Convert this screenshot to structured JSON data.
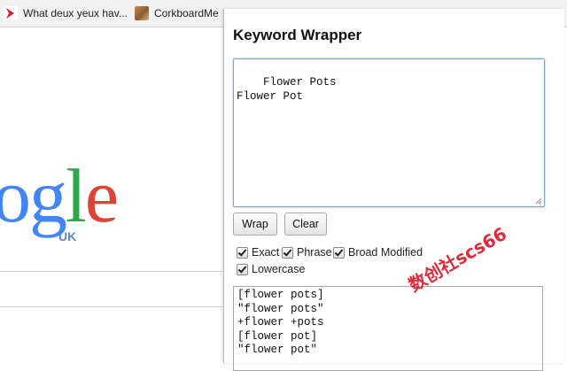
{
  "bookmarks": [
    {
      "label": "What deux yeux hav...",
      "icon": "red-arrow-icon"
    },
    {
      "label": "CorkboardMe",
      "icon": "photo-icon"
    }
  ],
  "google": {
    "logo_letters": [
      "o",
      "g",
      "l",
      "e"
    ],
    "region": "UK",
    "colors": {
      "blue": "#4285f4",
      "green": "#2ea84a",
      "red": "#db4437"
    }
  },
  "popup": {
    "title": "Keyword Wrapper",
    "input_value": "Flower Pots\nFlower Pot",
    "buttons": {
      "wrap": "Wrap",
      "clear": "Clear"
    },
    "options": {
      "exact": {
        "label": "Exact",
        "checked": true
      },
      "phrase": {
        "label": "Phrase",
        "checked": true
      },
      "broad_modified": {
        "label": "Broad Modified",
        "checked": true
      },
      "lowercase": {
        "label": "Lowercase",
        "checked": true
      }
    },
    "output_lines": [
      "[flower pots]",
      "\"flower pots\"",
      "+flower +pots",
      "[flower pot]",
      "\"flower pot\""
    ]
  },
  "watermark": "数创社scs66"
}
